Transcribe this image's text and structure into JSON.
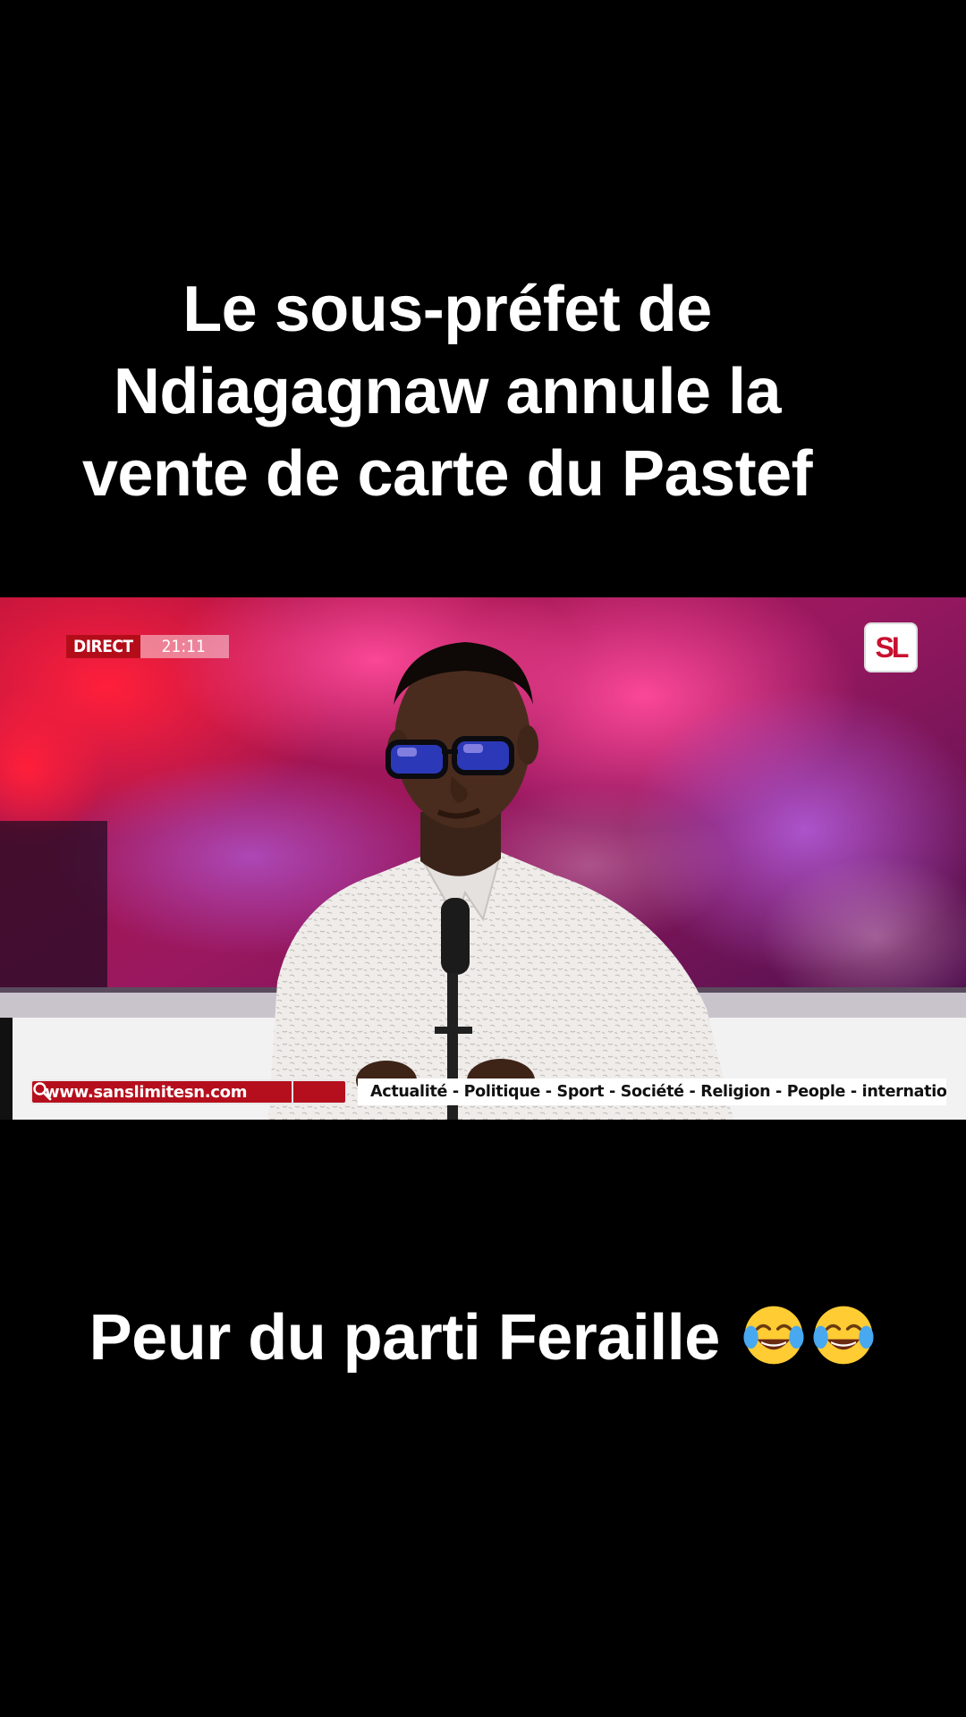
{
  "caption_top": {
    "lines": [
      "Le sous-préfet de",
      "Ndiagagnaw annule la",
      "vente de carte du Pastef"
    ]
  },
  "video": {
    "direct_label": "DIRECT",
    "direct_time": "21:11",
    "channel_logo_text": "SL",
    "website": "www.sanslimitesn.com",
    "topics": "Actualité - Politique - Sport - Société - Religion - People - international",
    "icons": {
      "search": "search-icon",
      "logo": "sl-logo",
      "emoji": "tears-of-joy-emoji"
    },
    "colors": {
      "accent_red": "#b40d1a",
      "backdrop_pink": "#e0206a",
      "backdrop_purple": "#6a1a7a"
    }
  },
  "caption_bottom": {
    "text": "Peur du parti Feraille"
  }
}
